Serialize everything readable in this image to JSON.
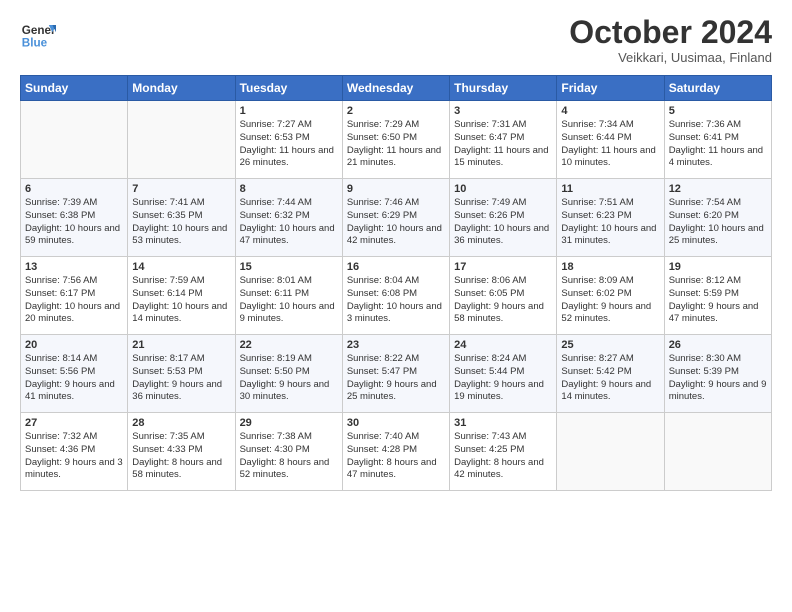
{
  "logo": {
    "text_general": "General",
    "text_blue": "Blue"
  },
  "header": {
    "title": "October 2024",
    "subtitle": "Veikkari, Uusimaa, Finland"
  },
  "weekdays": [
    "Sunday",
    "Monday",
    "Tuesday",
    "Wednesday",
    "Thursday",
    "Friday",
    "Saturday"
  ],
  "weeks": [
    [
      {
        "day": "",
        "content": ""
      },
      {
        "day": "",
        "content": ""
      },
      {
        "day": "1",
        "content": "Sunrise: 7:27 AM\nSunset: 6:53 PM\nDaylight: 11 hours and 26 minutes."
      },
      {
        "day": "2",
        "content": "Sunrise: 7:29 AM\nSunset: 6:50 PM\nDaylight: 11 hours and 21 minutes."
      },
      {
        "day": "3",
        "content": "Sunrise: 7:31 AM\nSunset: 6:47 PM\nDaylight: 11 hours and 15 minutes."
      },
      {
        "day": "4",
        "content": "Sunrise: 7:34 AM\nSunset: 6:44 PM\nDaylight: 11 hours and 10 minutes."
      },
      {
        "day": "5",
        "content": "Sunrise: 7:36 AM\nSunset: 6:41 PM\nDaylight: 11 hours and 4 minutes."
      }
    ],
    [
      {
        "day": "6",
        "content": "Sunrise: 7:39 AM\nSunset: 6:38 PM\nDaylight: 10 hours and 59 minutes."
      },
      {
        "day": "7",
        "content": "Sunrise: 7:41 AM\nSunset: 6:35 PM\nDaylight: 10 hours and 53 minutes."
      },
      {
        "day": "8",
        "content": "Sunrise: 7:44 AM\nSunset: 6:32 PM\nDaylight: 10 hours and 47 minutes."
      },
      {
        "day": "9",
        "content": "Sunrise: 7:46 AM\nSunset: 6:29 PM\nDaylight: 10 hours and 42 minutes."
      },
      {
        "day": "10",
        "content": "Sunrise: 7:49 AM\nSunset: 6:26 PM\nDaylight: 10 hours and 36 minutes."
      },
      {
        "day": "11",
        "content": "Sunrise: 7:51 AM\nSunset: 6:23 PM\nDaylight: 10 hours and 31 minutes."
      },
      {
        "day": "12",
        "content": "Sunrise: 7:54 AM\nSunset: 6:20 PM\nDaylight: 10 hours and 25 minutes."
      }
    ],
    [
      {
        "day": "13",
        "content": "Sunrise: 7:56 AM\nSunset: 6:17 PM\nDaylight: 10 hours and 20 minutes."
      },
      {
        "day": "14",
        "content": "Sunrise: 7:59 AM\nSunset: 6:14 PM\nDaylight: 10 hours and 14 minutes."
      },
      {
        "day": "15",
        "content": "Sunrise: 8:01 AM\nSunset: 6:11 PM\nDaylight: 10 hours and 9 minutes."
      },
      {
        "day": "16",
        "content": "Sunrise: 8:04 AM\nSunset: 6:08 PM\nDaylight: 10 hours and 3 minutes."
      },
      {
        "day": "17",
        "content": "Sunrise: 8:06 AM\nSunset: 6:05 PM\nDaylight: 9 hours and 58 minutes."
      },
      {
        "day": "18",
        "content": "Sunrise: 8:09 AM\nSunset: 6:02 PM\nDaylight: 9 hours and 52 minutes."
      },
      {
        "day": "19",
        "content": "Sunrise: 8:12 AM\nSunset: 5:59 PM\nDaylight: 9 hours and 47 minutes."
      }
    ],
    [
      {
        "day": "20",
        "content": "Sunrise: 8:14 AM\nSunset: 5:56 PM\nDaylight: 9 hours and 41 minutes."
      },
      {
        "day": "21",
        "content": "Sunrise: 8:17 AM\nSunset: 5:53 PM\nDaylight: 9 hours and 36 minutes."
      },
      {
        "day": "22",
        "content": "Sunrise: 8:19 AM\nSunset: 5:50 PM\nDaylight: 9 hours and 30 minutes."
      },
      {
        "day": "23",
        "content": "Sunrise: 8:22 AM\nSunset: 5:47 PM\nDaylight: 9 hours and 25 minutes."
      },
      {
        "day": "24",
        "content": "Sunrise: 8:24 AM\nSunset: 5:44 PM\nDaylight: 9 hours and 19 minutes."
      },
      {
        "day": "25",
        "content": "Sunrise: 8:27 AM\nSunset: 5:42 PM\nDaylight: 9 hours and 14 minutes."
      },
      {
        "day": "26",
        "content": "Sunrise: 8:30 AM\nSunset: 5:39 PM\nDaylight: 9 hours and 9 minutes."
      }
    ],
    [
      {
        "day": "27",
        "content": "Sunrise: 7:32 AM\nSunset: 4:36 PM\nDaylight: 9 hours and 3 minutes."
      },
      {
        "day": "28",
        "content": "Sunrise: 7:35 AM\nSunset: 4:33 PM\nDaylight: 8 hours and 58 minutes."
      },
      {
        "day": "29",
        "content": "Sunrise: 7:38 AM\nSunset: 4:30 PM\nDaylight: 8 hours and 52 minutes."
      },
      {
        "day": "30",
        "content": "Sunrise: 7:40 AM\nSunset: 4:28 PM\nDaylight: 8 hours and 47 minutes."
      },
      {
        "day": "31",
        "content": "Sunrise: 7:43 AM\nSunset: 4:25 PM\nDaylight: 8 hours and 42 minutes."
      },
      {
        "day": "",
        "content": ""
      },
      {
        "day": "",
        "content": ""
      }
    ]
  ]
}
